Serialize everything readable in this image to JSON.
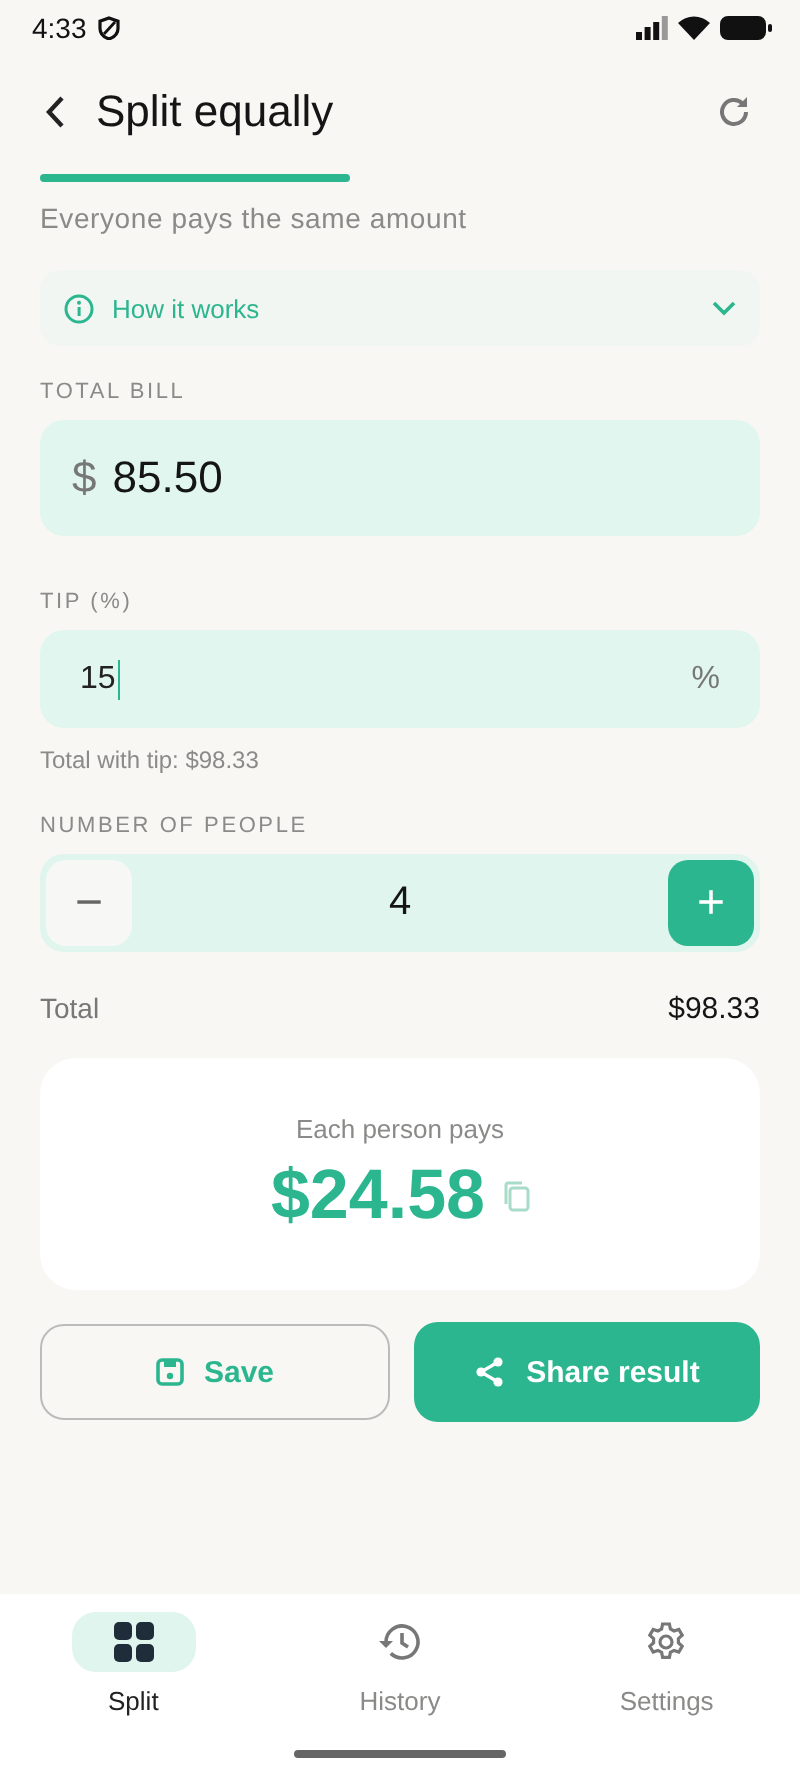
{
  "status_bar": {
    "time": "4:33"
  },
  "header": {
    "title": "Split equally",
    "subtitle": "Everyone pays the same amount"
  },
  "info": {
    "label": "How it works",
    "expanded": false
  },
  "bill": {
    "label": "TOTAL BILL",
    "currency": "$",
    "value": "85.50"
  },
  "tip": {
    "label": "TIP (%)",
    "value": "15",
    "suffix": "%",
    "focused": true,
    "helper": "Total with tip: $98.33"
  },
  "people": {
    "label": "NUMBER OF PEOPLE",
    "minus": "−",
    "value": "4",
    "plus": "+"
  },
  "total": {
    "label": "Total",
    "value": "$98.33"
  },
  "result": {
    "label": "Each person pays",
    "amount": "$24.58"
  },
  "buttons": [
    {
      "label": "Save",
      "kind": "outline"
    },
    {
      "label": "Share result",
      "kind": "filled"
    }
  ],
  "nav": [
    {
      "label": "Split",
      "kind": "split",
      "selected": true
    },
    {
      "label": "History",
      "kind": "history",
      "selected": false
    },
    {
      "label": "Settings",
      "kind": "settings",
      "selected": false
    }
  ]
}
